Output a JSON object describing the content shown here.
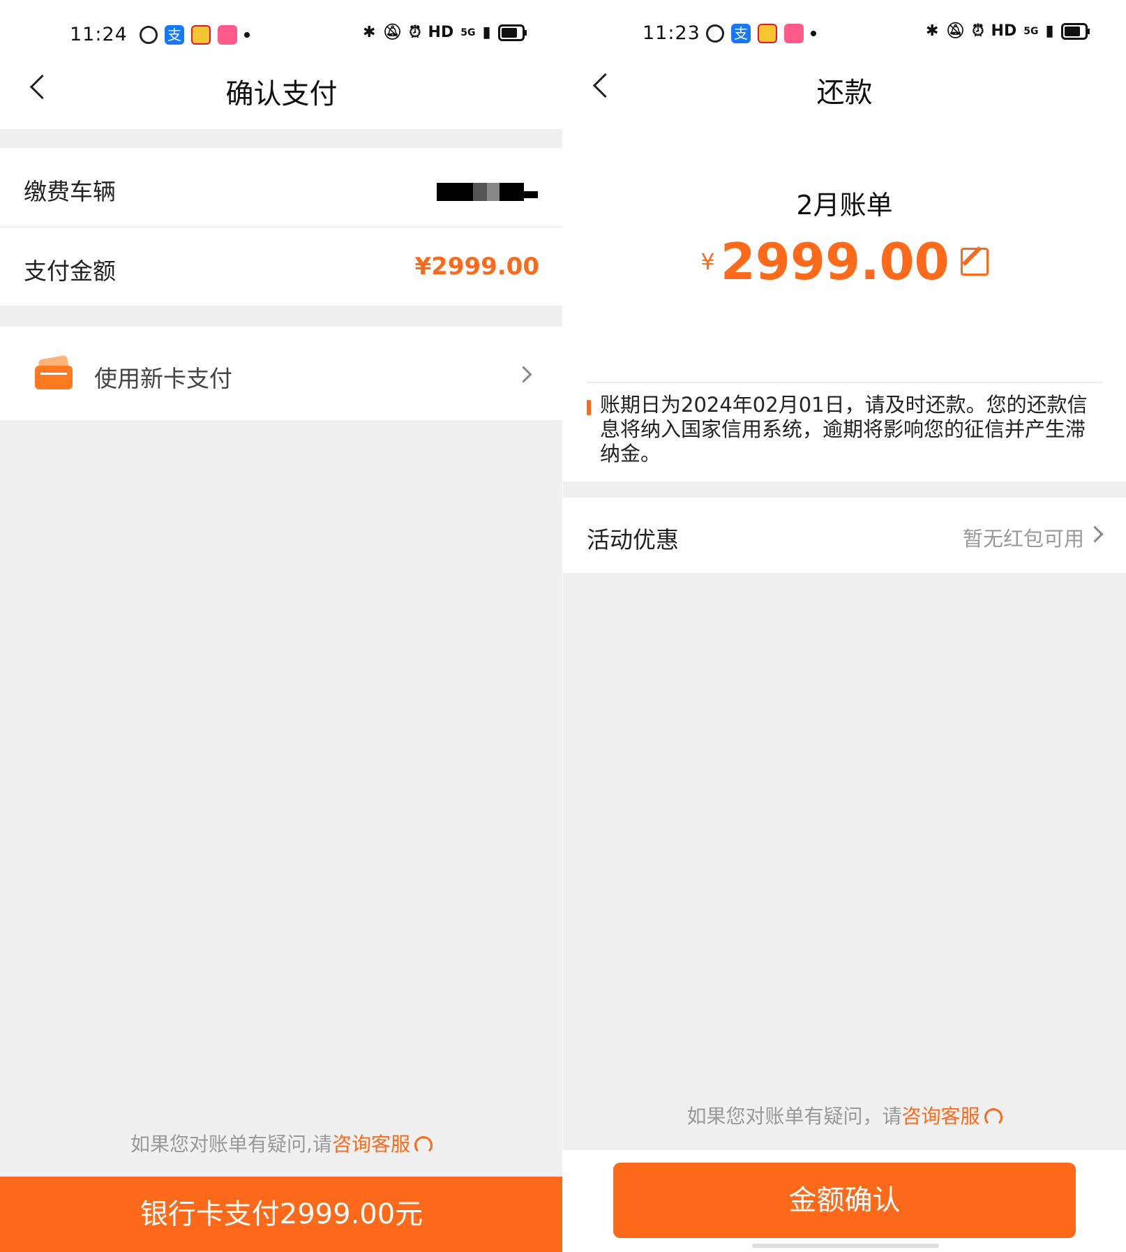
{
  "left": {
    "status": {
      "time": "11:24",
      "hd": "HD",
      "net": "5G"
    },
    "header": {
      "title": "确认支付"
    },
    "vehicle": {
      "label": "缴费车辆"
    },
    "amount": {
      "label": "支付金额",
      "value": "¥2999.00"
    },
    "payment": {
      "new_card_label": "使用新卡支付"
    },
    "help": {
      "prefix": "如果您对账单有疑问,请",
      "link": "咨询客服"
    },
    "pay_button": "银行卡支付2999.00元"
  },
  "right": {
    "status": {
      "time": "11:23",
      "hd": "HD",
      "net": "5G"
    },
    "header": {
      "title": "还款"
    },
    "bill": {
      "title": "2月账单",
      "currency": "¥",
      "amount": "2999.00",
      "notice": "账期日为2024年02月01日，请及时还款。您的还款信息将纳入国家信用系统，逾期将影响您的征信并产生滞纳金。"
    },
    "promo": {
      "label": "活动优惠",
      "value": "暂无红包可用"
    },
    "help": {
      "prefix": "如果您对账单有疑问，请",
      "link": "咨询客服"
    },
    "confirm_button": "金额确认"
  },
  "colors": {
    "accent": "#ff6a1a",
    "background": "#f0f0f0"
  }
}
